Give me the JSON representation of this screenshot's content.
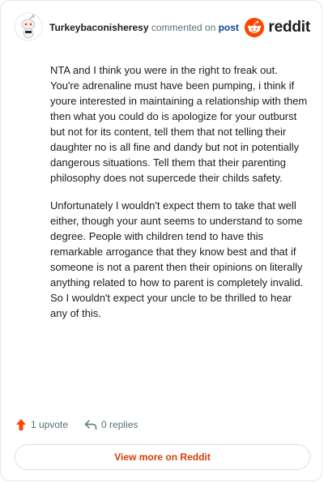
{
  "header": {
    "username": "Turkeybaconisheresy",
    "action_text": "commented on",
    "post_link": "post",
    "brand": "reddit"
  },
  "comment": {
    "paragraphs": [
      "NTA and I think you were in the right to freak out. You're adrenaline must have been pumping, i think if youre interested in maintaining a relationship with them then what you could do is apologize for your outburst but not for its content, tell them that not telling their daughter no is all fine and dandy but not in potentially dangerous situations. Tell them that their parenting philosophy does not supercede their childs safety.",
      "Unfortunately I wouldn't expect them to take that well either, though your aunt seems to understand to some degree. People with children tend to have this remarkable arrogance that they know best and that if someone is not a parent then their opinions on literally anything related to how to parent is completely invalid. So I wouldn't expect your uncle to be thrilled to hear any of this."
    ]
  },
  "footer": {
    "upvotes": "1 upvote",
    "replies": "0 replies"
  },
  "view_button": "View more on Reddit",
  "colors": {
    "brand_orange": "#ff4500",
    "link_blue": "#0a449b",
    "button_text": "#d93a00",
    "muted": "#576f76"
  },
  "icons": {
    "avatar": "snoo-avatar-icon",
    "logo": "reddit-logo-icon",
    "upvote": "upvote-arrow-icon",
    "reply": "reply-arrow-icon"
  }
}
